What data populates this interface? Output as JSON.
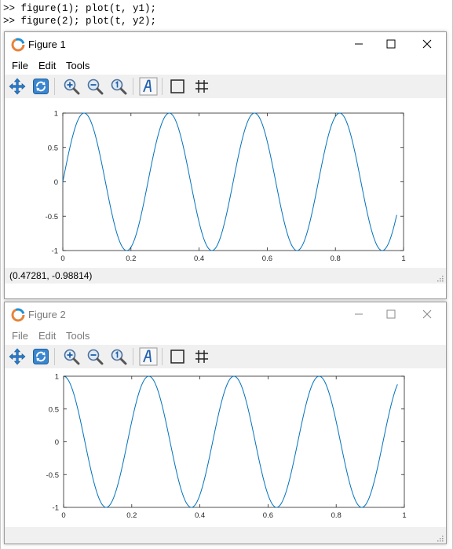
{
  "console": {
    "lines": [
      {
        "prompt": ">>",
        "code": " figure(1); plot(t, y1);"
      },
      {
        "prompt": ">>",
        "code": " figure(2); plot(t, y2);"
      }
    ]
  },
  "figure1": {
    "title": "Figure 1",
    "state": "active",
    "menu": [
      "File",
      "Edit",
      "Tools"
    ],
    "toolbar_icons": [
      "pan-icon",
      "rotate-icon",
      "zoom-in-icon",
      "zoom-out-icon",
      "zoom-reset-icon",
      "insert-text-icon",
      "toggle-axes-box-icon",
      "toggle-grid-icon"
    ],
    "status": "(0.47281, -0.98814)"
  },
  "figure2": {
    "title": "Figure 2",
    "state": "inactive",
    "menu": [
      "File",
      "Edit",
      "Tools"
    ],
    "toolbar_icons": [
      "pan-icon",
      "rotate-icon",
      "zoom-in-icon",
      "zoom-out-icon",
      "zoom-reset-icon",
      "insert-text-icon",
      "toggle-axes-box-icon",
      "toggle-grid-icon"
    ],
    "status": ""
  },
  "colors": {
    "line": "#0072bd",
    "toolbar_bg": "#f0f0f0",
    "axes": "#262626"
  },
  "chart_data": [
    {
      "type": "line",
      "title": "",
      "xlabel": "",
      "ylabel": "",
      "xlim": [
        0,
        1
      ],
      "ylim": [
        -1,
        1
      ],
      "xticks": [
        "0",
        "0.2",
        "0.4",
        "0.6",
        "0.8",
        "1"
      ],
      "yticks": [
        "-1",
        "-0.5",
        "0",
        "0.5",
        "1"
      ],
      "grid": false,
      "function": "sin(2*pi*4*t)",
      "t_range": [
        0,
        0.98
      ],
      "series": [
        {
          "x": [
            0,
            0.031,
            0.0625,
            0.094,
            0.125,
            0.156,
            0.1875,
            0.219,
            0.25,
            0.281,
            0.3125,
            0.344,
            0.375,
            0.406,
            0.4375,
            0.469,
            0.5,
            0.531,
            0.5625,
            0.594,
            0.625,
            0.656,
            0.6875,
            0.719,
            0.75,
            0.781,
            0.8125,
            0.844,
            0.875,
            0.906,
            0.9375,
            0.969,
            0.98
          ],
          "y": [
            0,
            0.707,
            1,
            0.707,
            0,
            -0.707,
            -1,
            -0.707,
            0,
            0.707,
            1,
            0.707,
            0,
            -0.707,
            -1,
            -0.707,
            0,
            0.707,
            1,
            0.707,
            0,
            -0.707,
            -1,
            -0.707,
            0,
            0.707,
            1,
            0.707,
            0,
            -0.707,
            -1,
            -0.707,
            -0.482
          ]
        }
      ]
    },
    {
      "type": "line",
      "title": "",
      "xlabel": "",
      "ylabel": "",
      "xlim": [
        0,
        1
      ],
      "ylim": [
        -1,
        1
      ],
      "xticks": [
        "0",
        "0.2",
        "0.4",
        "0.6",
        "0.8",
        "1"
      ],
      "yticks": [
        "-1",
        "-0.5",
        "0",
        "0.5",
        "1"
      ],
      "grid": false,
      "function": "cos(2*pi*4*t)",
      "t_range": [
        0,
        0.98
      ],
      "series": [
        {
          "x": [
            0,
            0.031,
            0.0625,
            0.094,
            0.125,
            0.156,
            0.1875,
            0.219,
            0.25,
            0.281,
            0.3125,
            0.344,
            0.375,
            0.406,
            0.4375,
            0.469,
            0.5,
            0.531,
            0.5625,
            0.594,
            0.625,
            0.656,
            0.6875,
            0.719,
            0.75,
            0.781,
            0.8125,
            0.844,
            0.875,
            0.906,
            0.9375,
            0.969,
            0.98
          ],
          "y": [
            1,
            0.707,
            0,
            -0.707,
            -1,
            -0.707,
            0,
            0.707,
            1,
            0.707,
            0,
            -0.707,
            -1,
            -0.707,
            0,
            0.707,
            1,
            0.707,
            0,
            -0.707,
            -1,
            -0.707,
            0,
            0.707,
            1,
            0.707,
            0,
            -0.707,
            -1,
            -0.707,
            0,
            0.707,
            0.876
          ]
        }
      ]
    }
  ]
}
